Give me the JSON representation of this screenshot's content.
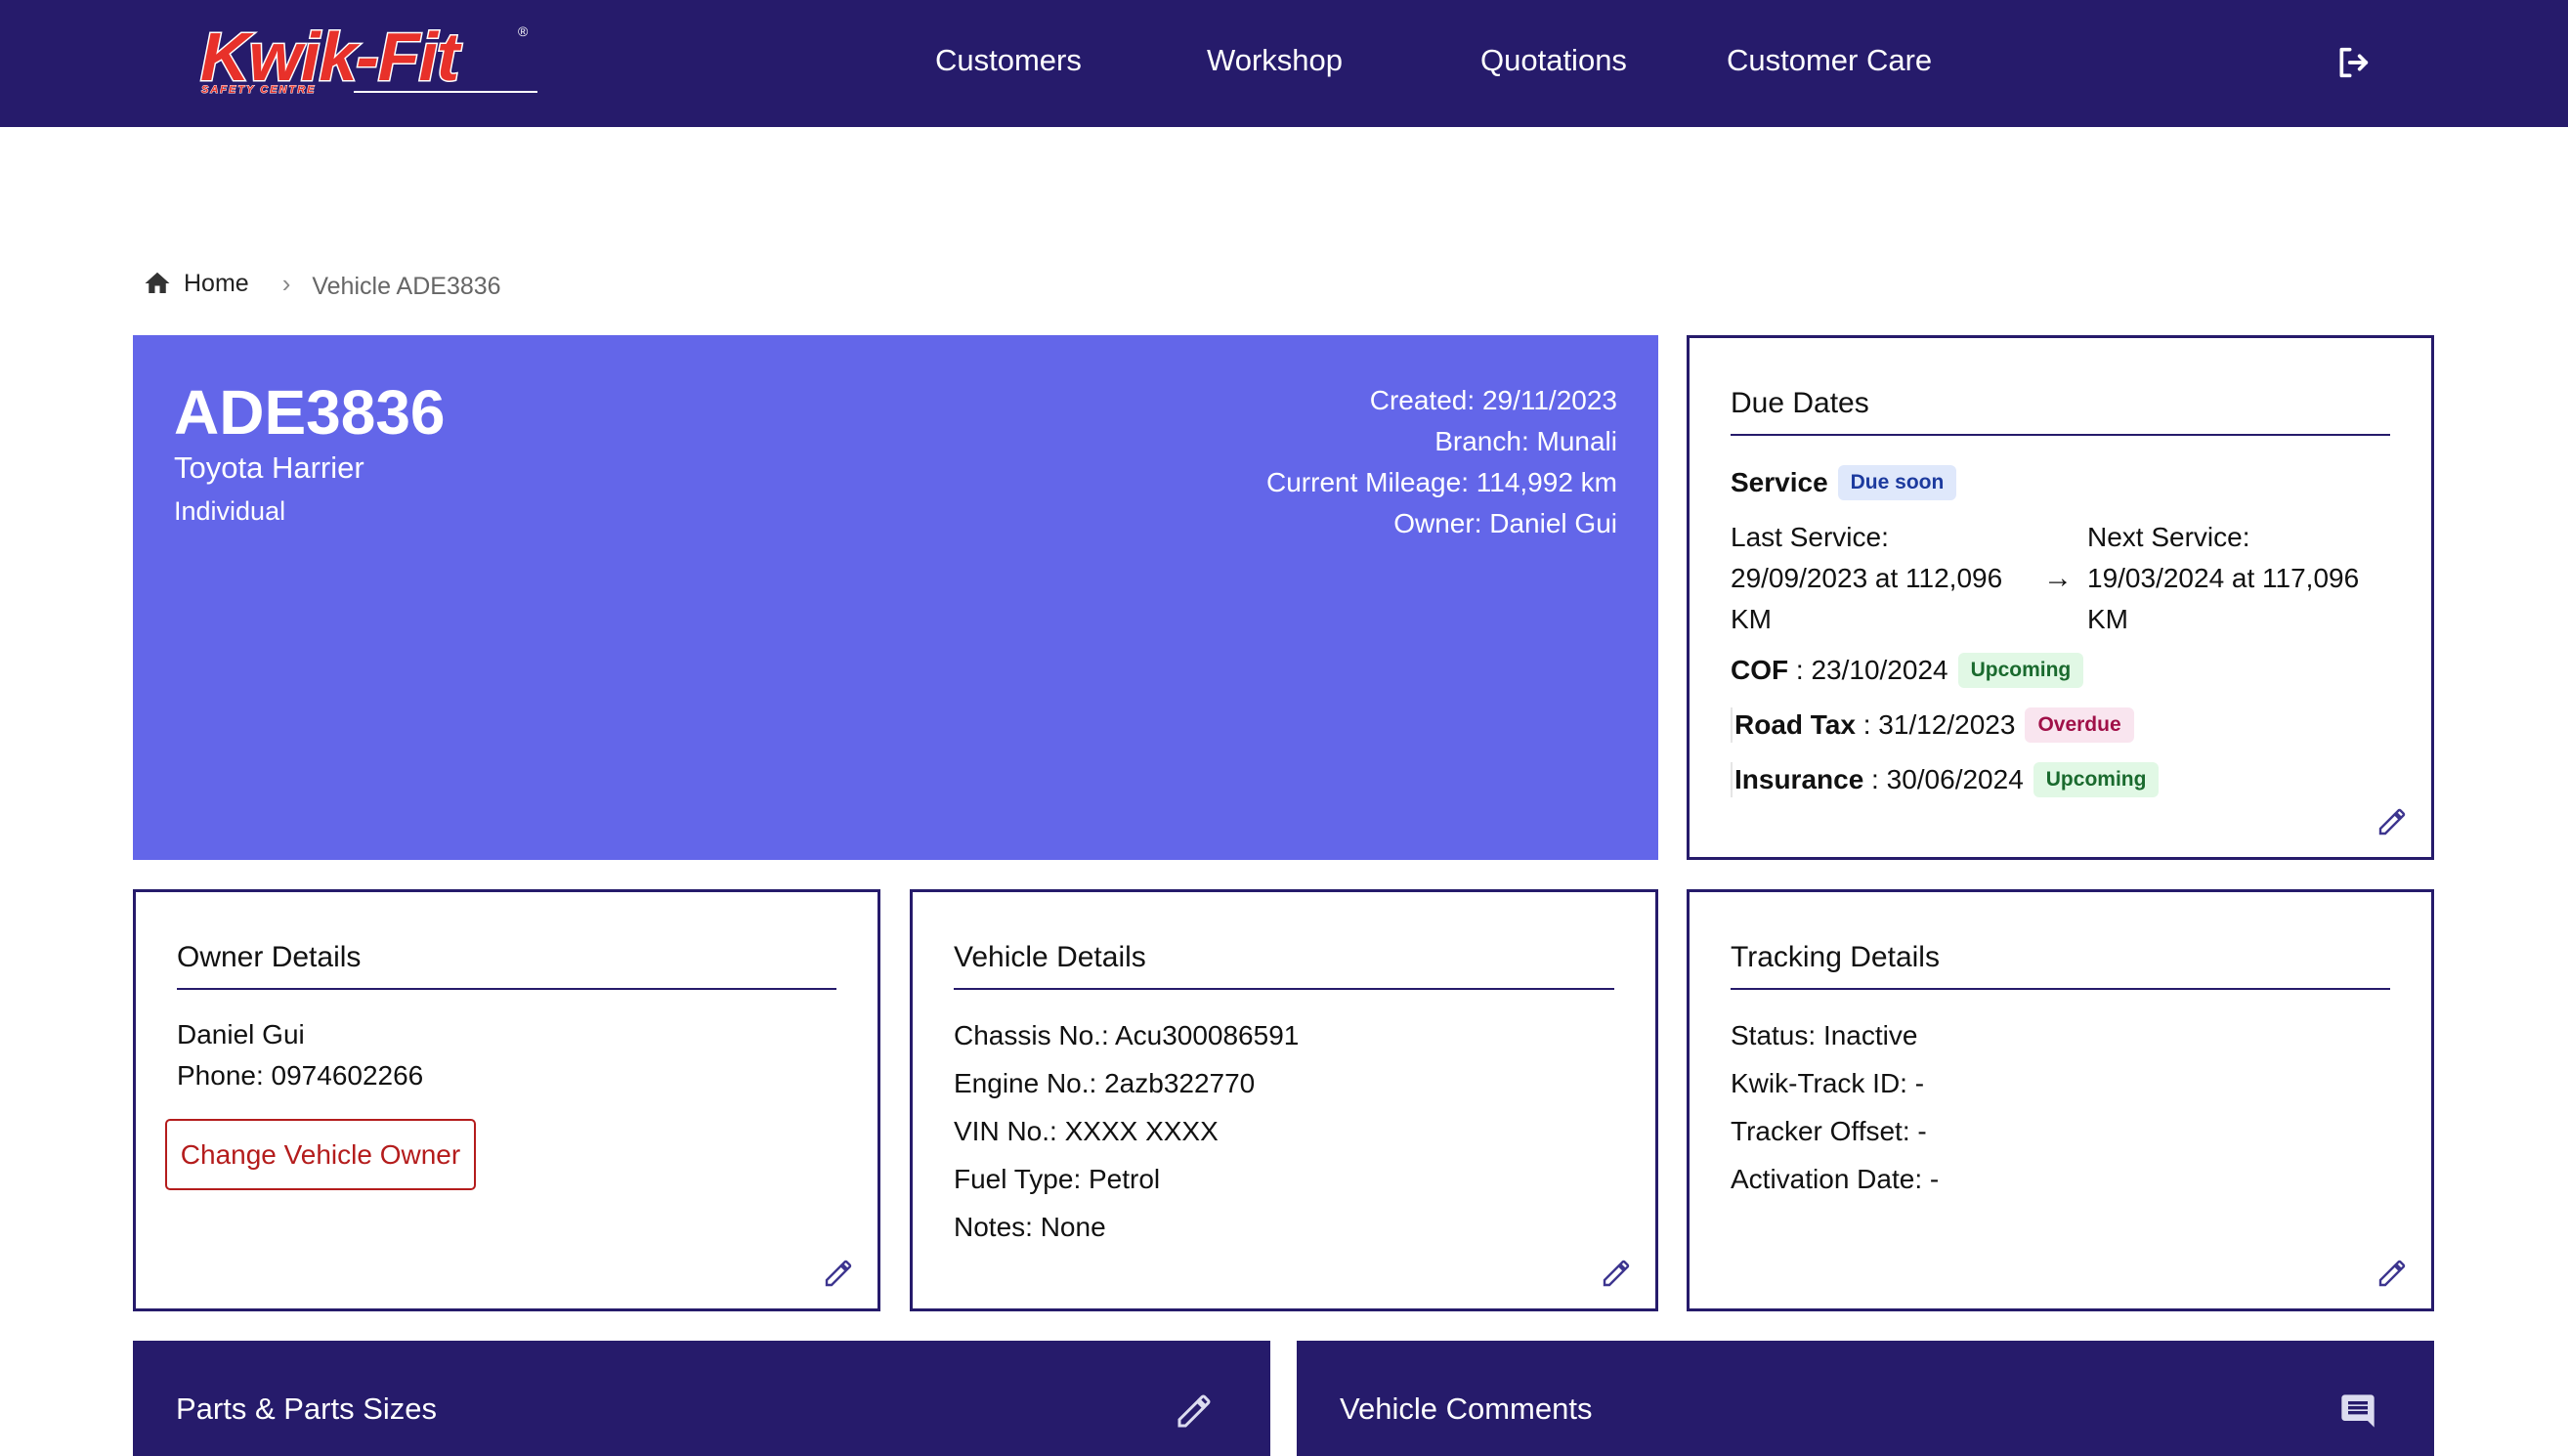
{
  "header": {
    "logo": {
      "word": "Kwik-Fit",
      "registered": "®",
      "tagline": "SAFETY CENTRE"
    },
    "nav": [
      "Customers",
      "Workshop",
      "Quotations",
      "Customer Care"
    ],
    "logout_icon": "logout-icon"
  },
  "breadcrumb": {
    "home": "Home",
    "separator": "›",
    "current": "Vehicle ADE3836"
  },
  "hero": {
    "plate": "ADE3836",
    "model": "Toyota Harrier",
    "owner_type": "Individual",
    "created": "Created: 29/11/2023",
    "branch": "Branch: Munali",
    "mileage": "Current Mileage: 114,992 km",
    "owner": "Owner: Daniel Gui",
    "color": "#6366e9"
  },
  "due_dates": {
    "title": "Due Dates",
    "service": {
      "label": "Service",
      "badge": "Due soon",
      "last_label": "Last Service:",
      "last_value": "29/09/2023 at 112,096",
      "last_unit": "KM",
      "arrow": "→",
      "next_label": "Next Service:",
      "next_value": "19/03/2024 at 117,096",
      "next_unit": "KM"
    },
    "cof": {
      "label": "COF",
      "sep": " : ",
      "date": "23/10/2024",
      "badge": "Upcoming"
    },
    "road_tax": {
      "label": "Road Tax",
      "sep": " : ",
      "date": "31/12/2023",
      "badge": "Overdue"
    },
    "insurance": {
      "label": "Insurance",
      "sep": " : ",
      "date": "30/06/2024",
      "badge": "Upcoming"
    }
  },
  "owner_details": {
    "title": "Owner Details",
    "name": "Daniel Gui",
    "phone": "Phone: 0974602266",
    "change_button": "Change Vehicle Owner"
  },
  "vehicle_details": {
    "title": "Vehicle Details",
    "lines": [
      "Chassis No.: Acu300086591",
      "Engine No.: 2azb322770",
      "VIN No.: XXXX XXXX",
      "Fuel Type: Petrol",
      "Notes: None"
    ]
  },
  "tracking_details": {
    "title": "Tracking Details",
    "lines": [
      "Status: Inactive",
      "Kwik-Track ID: -",
      "Tracker Offset: -",
      "Activation Date: -"
    ]
  },
  "sections": {
    "parts": "Parts & Parts Sizes",
    "comments": "Vehicle Comments"
  },
  "colors": {
    "brand_navy": "#261b6b",
    "hero_indigo": "#6366e9",
    "logo_red": "#e8312a",
    "danger": "#b41c1c"
  }
}
